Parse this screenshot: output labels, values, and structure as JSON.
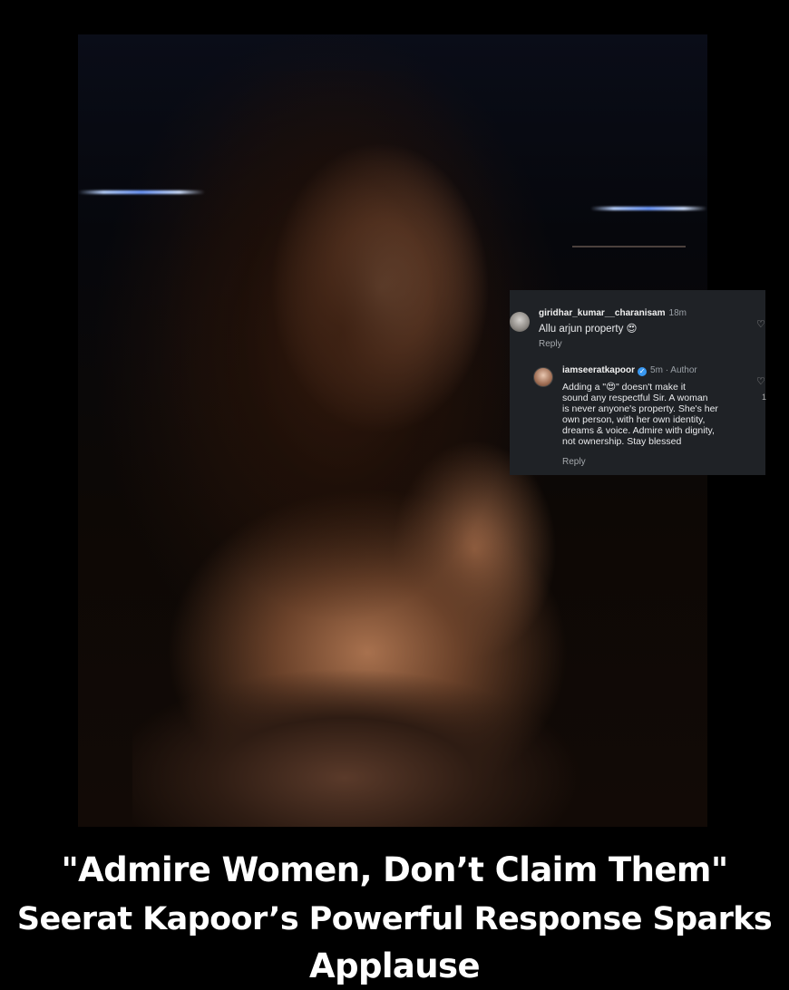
{
  "photo": {
    "subject": "woman selfie at night in satin top"
  },
  "comments": [
    {
      "username": "giridhar_kumar__charanisam",
      "time": "18m",
      "text": "Allu arjun property 😍",
      "reply_label": "Reply"
    },
    {
      "username": "iamseeratkapoor",
      "time": "5m · Author",
      "text_lines": [
        "Adding a \"😍\" doesn't make it",
        "sound any respectful Sir. A woman",
        "is never anyone's property. She's her",
        "own person, with her own identity,",
        "dreams & voice. Admire with dignity,",
        "not ownership. Stay blessed"
      ],
      "reply_label": "Reply",
      "like_count": "1"
    }
  ],
  "headline": {
    "line1": "\"Admire Women, Don’t Claim Them\"",
    "line2": "Seerat Kapoor’s Powerful Response Sparks",
    "line3": "Applause"
  },
  "colors": {
    "background": "#000000",
    "card": "#1f2226",
    "verified": "#3897f0"
  }
}
